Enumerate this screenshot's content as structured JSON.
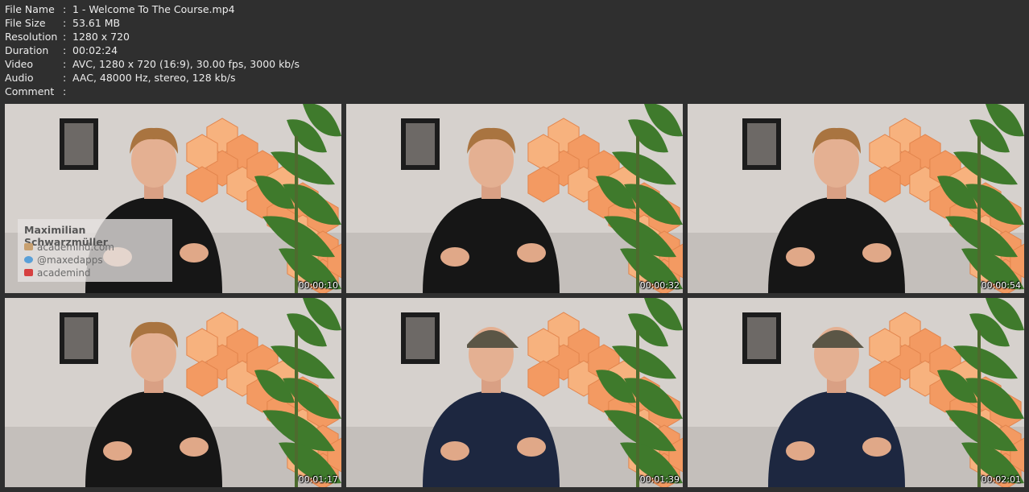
{
  "info": [
    {
      "key": "File Name",
      "sep": ":",
      "value": "1 - Welcome To The Course.mp4"
    },
    {
      "key": "File Size",
      "sep": ":",
      "value": "53.61 MB"
    },
    {
      "key": "Resolution",
      "sep": ":",
      "value": "1280 x 720"
    },
    {
      "key": "Duration",
      "sep": ":",
      "value": "00:02:24"
    },
    {
      "key": "Video",
      "sep": ":",
      "value": "AVC, 1280 x 720 (16:9), 30.00 fps, 3000 kb/s"
    },
    {
      "key": "Audio",
      "sep": ":",
      "value": "AAC, 48000 Hz, stereo, 128 kb/s"
    },
    {
      "key": "Comment",
      "sep": ":",
      "value": ""
    }
  ],
  "lower_third": {
    "name": "Maximilian Schwarzmüller",
    "website": "academind.com",
    "twitter": "@maxedapps",
    "youtube": "academind"
  },
  "thumbnails": [
    {
      "timestamp": "00:00:10",
      "shirt": "#161616",
      "hat": false
    },
    {
      "timestamp": "00:00:32",
      "shirt": "#161616",
      "hat": false
    },
    {
      "timestamp": "00:00:54",
      "shirt": "#161616",
      "hat": false
    },
    {
      "timestamp": "00:01:17",
      "shirt": "#161616",
      "hat": false
    },
    {
      "timestamp": "00:01:39",
      "shirt": "#1d2740",
      "hat": true
    },
    {
      "timestamp": "00:02:01",
      "shirt": "#1d2740",
      "hat": true
    }
  ],
  "colors": {
    "background": "#2f2f2f",
    "text": "#ececec",
    "panel_orange": "#f39a62"
  }
}
